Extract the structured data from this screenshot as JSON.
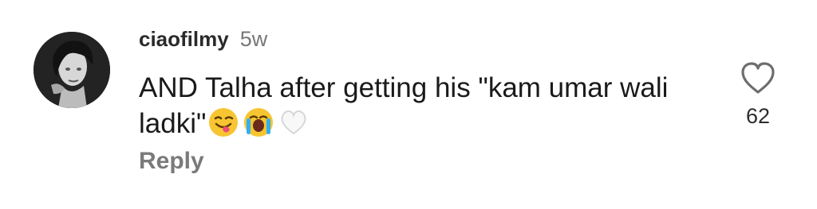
{
  "comment": {
    "username": "ciaofilmy",
    "time": "5w",
    "text": "AND Talha after getting his \"kam umar wali ladki\"",
    "emojis": [
      "😋",
      "😭",
      "🤍"
    ],
    "reply_label": "Reply",
    "like_count": "62"
  },
  "icons": {
    "avatar": "avatar",
    "like": "heart-outline-icon"
  },
  "colors": {
    "username": "#2a2a2a",
    "time": "#777777",
    "reply": "#7a7a7a",
    "heart": "#6d6d6d"
  }
}
